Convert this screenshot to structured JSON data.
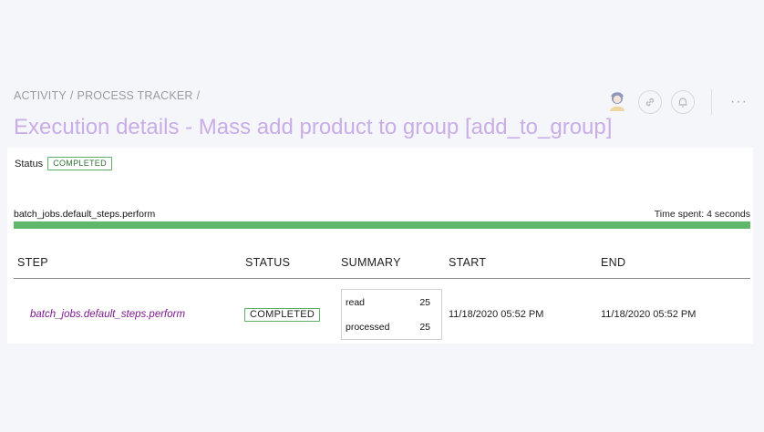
{
  "breadcrumb": {
    "items": [
      "ACTIVITY",
      "PROCESS TRACKER"
    ],
    "separator": "/"
  },
  "page": {
    "title": "Execution details - Mass add product to group [add_to_group]"
  },
  "header": {
    "icons": [
      "avatar",
      "link-icon",
      "bell-icon",
      "more-icon"
    ],
    "more_label": "···"
  },
  "status": {
    "label": "Status",
    "value": "COMPLETED"
  },
  "progress": {
    "step_name": "batch_jobs.default_steps.perform",
    "time_spent": "Time spent: 4 seconds",
    "fill_fraction": 1.0,
    "color": "#5fb86a"
  },
  "table": {
    "columns": [
      "STEP",
      "STATUS",
      "SUMMARY",
      "START",
      "END"
    ],
    "rows": [
      {
        "step": "batch_jobs.default_steps.perform",
        "status": "COMPLETED",
        "summary": [
          {
            "label": "read",
            "value": "25"
          },
          {
            "label": "processed",
            "value": "25"
          }
        ],
        "start": "11/18/2020 05:52 PM",
        "end": "11/18/2020 05:52 PM"
      }
    ]
  },
  "colors": {
    "accent_title": "#c9aee6",
    "success": "#5fb86a",
    "step_link": "#7a1a8c"
  }
}
